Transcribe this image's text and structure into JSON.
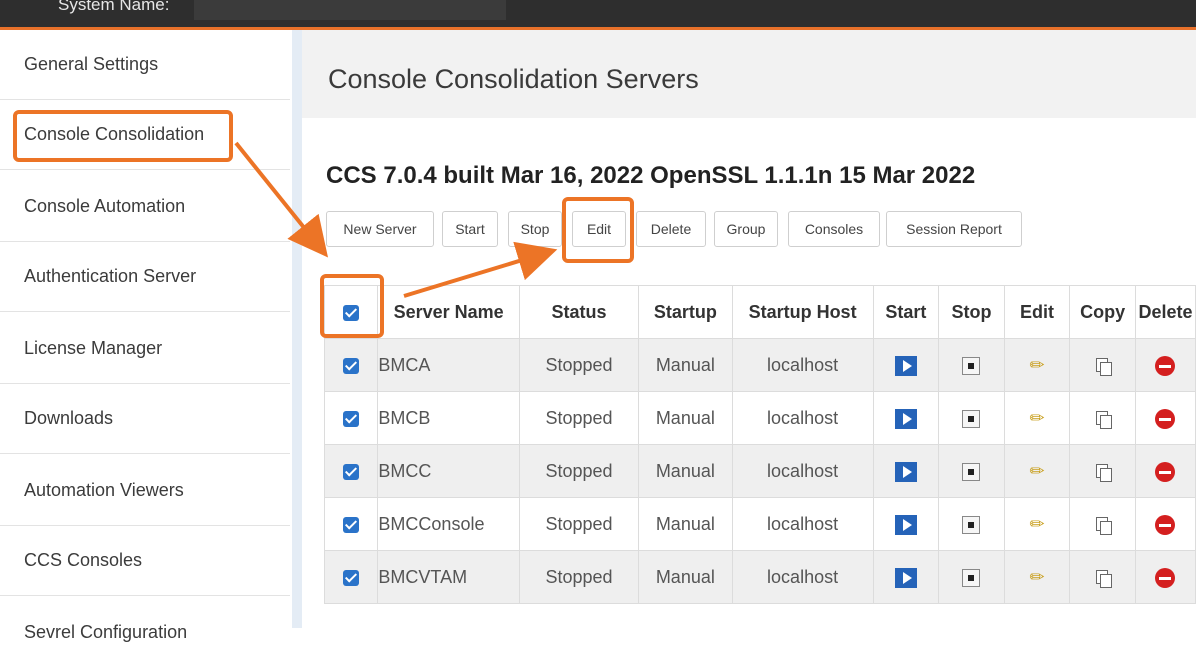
{
  "topbar": {
    "system_name_label": "System Name:"
  },
  "sidebar": {
    "items": [
      {
        "label": "General Settings"
      },
      {
        "label": "Console Consolidation"
      },
      {
        "label": "Console Automation"
      },
      {
        "label": "Authentication Server"
      },
      {
        "label": "License Manager"
      },
      {
        "label": "Downloads"
      },
      {
        "label": "Automation Viewers"
      },
      {
        "label": "CCS Consoles"
      },
      {
        "label": "Sevrel Configuration"
      }
    ]
  },
  "main": {
    "title": "Console Consolidation Servers",
    "subtitle": "CCS 7.0.4 built Mar 16, 2022 OpenSSL 1.1.1n 15 Mar 2022",
    "toolbar": {
      "new_server": "New Server",
      "start": "Start",
      "stop": "Stop",
      "edit": "Edit",
      "delete": "Delete",
      "group": "Group",
      "consoles": "Consoles",
      "session_report": "Session Report"
    },
    "table": {
      "columns": [
        "Server Name",
        "Status",
        "Startup",
        "Startup Host",
        "Start",
        "Stop",
        "Edit",
        "Copy",
        "Delete"
      ],
      "rows": [
        {
          "name": "BMCA",
          "status": "Stopped",
          "startup": "Manual",
          "host": "localhost"
        },
        {
          "name": "BMCB",
          "status": "Stopped",
          "startup": "Manual",
          "host": "localhost"
        },
        {
          "name": "BMCC",
          "status": "Stopped",
          "startup": "Manual",
          "host": "localhost"
        },
        {
          "name": "BMCConsole",
          "status": "Stopped",
          "startup": "Manual",
          "host": "localhost"
        },
        {
          "name": "BMCVTAM",
          "status": "Stopped",
          "startup": "Manual",
          "host": "localhost"
        }
      ]
    }
  },
  "colors": {
    "accent": "#ec7426",
    "checkbox": "#2a73c9",
    "play": "#2563b8",
    "delete": "#d41f1f"
  },
  "icons": [
    "checkbox-checked-icon",
    "play-icon",
    "stop-icon",
    "pencil-icon",
    "copy-icon",
    "delete-icon"
  ]
}
